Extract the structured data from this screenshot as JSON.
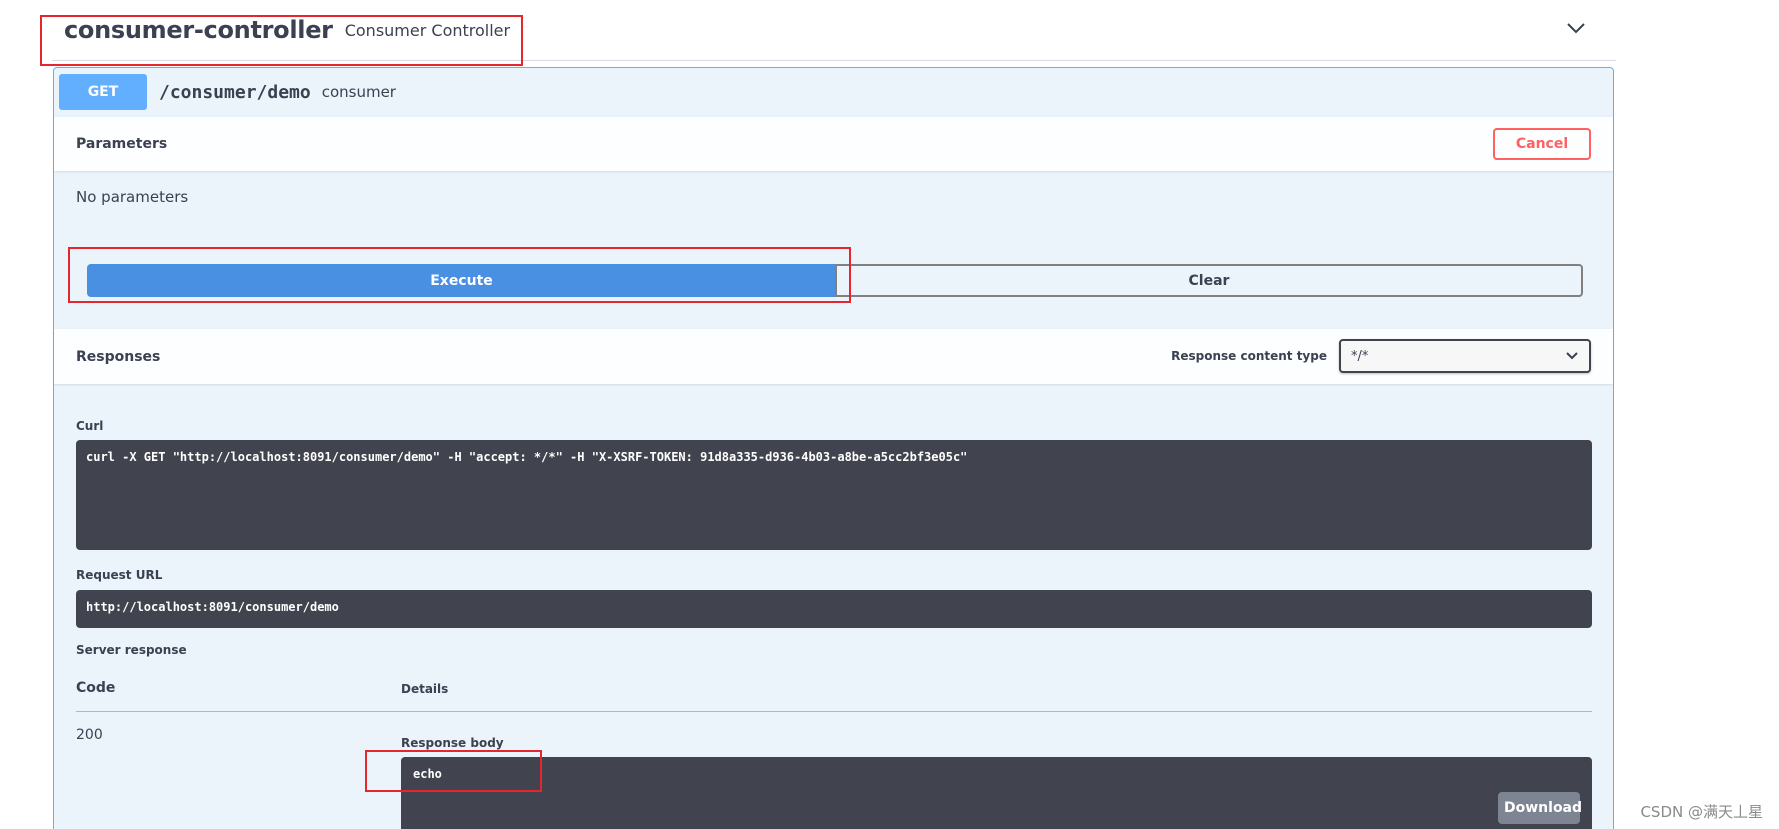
{
  "tag": {
    "name": "consumer-controller",
    "description": "Consumer Controller"
  },
  "operation": {
    "method": "GET",
    "path": "/consumer/demo",
    "summary": "consumer"
  },
  "parameters": {
    "title": "Parameters",
    "cancel_label": "Cancel",
    "empty_text": "No parameters"
  },
  "actions": {
    "execute_label": "Execute",
    "clear_label": "Clear"
  },
  "responses": {
    "title": "Responses",
    "content_type_label": "Response content type",
    "content_type_value": "*/*"
  },
  "curl": {
    "label": "Curl",
    "command": "curl -X GET \"http://localhost:8091/consumer/demo\" -H \"accept: */*\" -H \"X-XSRF-TOKEN: 91d8a335-d936-4b03-a8be-a5cc2bf3e05c\""
  },
  "request_url": {
    "label": "Request URL",
    "value": "http://localhost:8091/consumer/demo"
  },
  "server_response": {
    "label": "Server response",
    "code_header": "Code",
    "details_header": "Details",
    "code": "200",
    "body_label": "Response body",
    "body": "echo",
    "download_label": "Download"
  },
  "watermark": "CSDN @满天丄星",
  "colors": {
    "get_badge": "#61affe",
    "execute": "#4990e2",
    "cancel": "#ff6060",
    "code_bg": "#41444e",
    "annotation": "#e5262f"
  }
}
